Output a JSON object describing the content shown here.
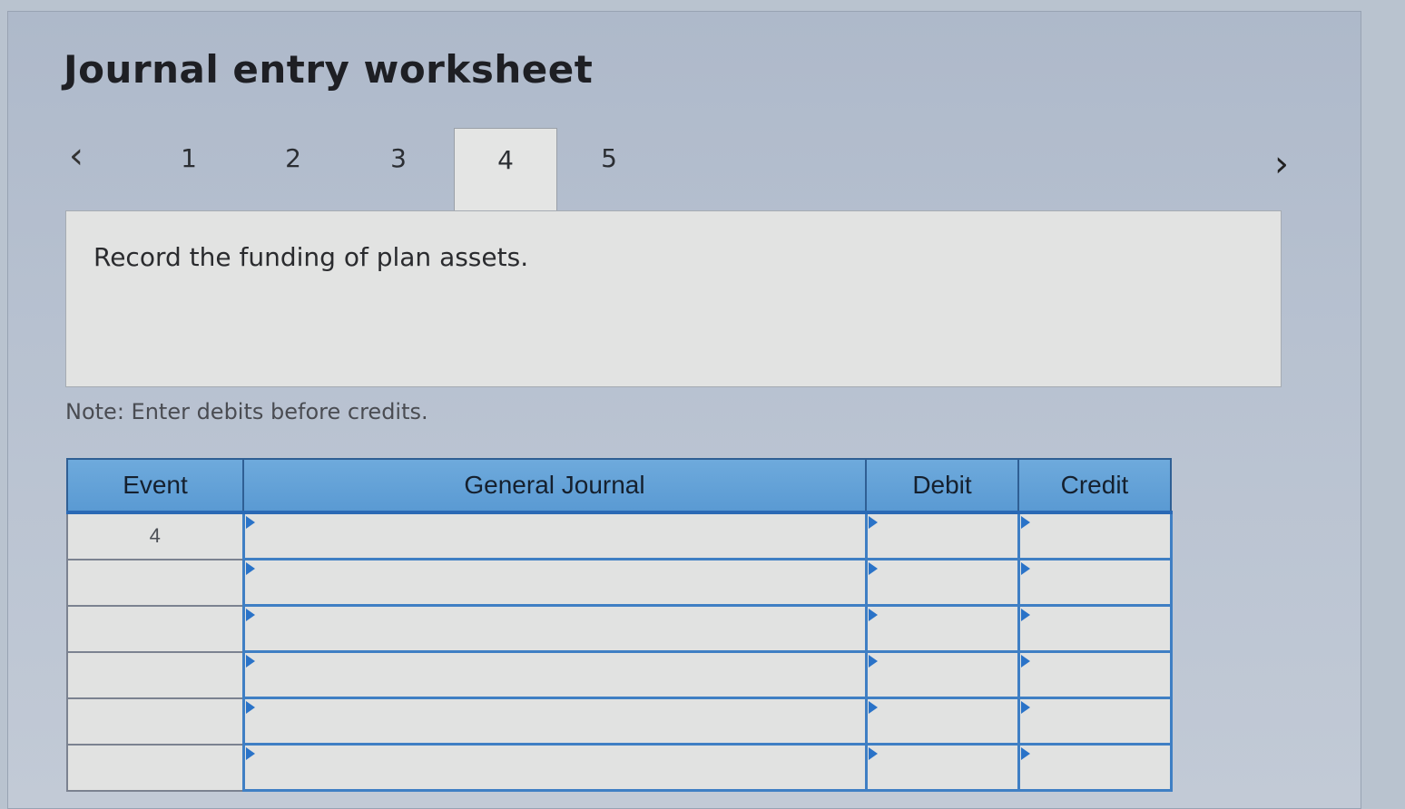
{
  "header": {
    "title": "Journal entry worksheet"
  },
  "nav": {
    "prev_icon": "chevron-left-icon",
    "next_icon": "chevron-right-icon",
    "prev_glyph": "‹",
    "next_glyph": "›",
    "tabs": [
      "1",
      "2",
      "3",
      "4",
      "5"
    ],
    "active_tab": "4"
  },
  "prompt": {
    "text": "Record the funding of plan assets."
  },
  "note": "Note: Enter debits before credits.",
  "table": {
    "headers": [
      "Event",
      "General Journal",
      "Debit",
      "Credit"
    ],
    "rows": [
      {
        "event": "4",
        "account": "",
        "debit": "",
        "credit": ""
      },
      {
        "event": "",
        "account": "",
        "debit": "",
        "credit": ""
      },
      {
        "event": "",
        "account": "",
        "debit": "",
        "credit": ""
      },
      {
        "event": "",
        "account": "",
        "debit": "",
        "credit": ""
      },
      {
        "event": "",
        "account": "",
        "debit": "",
        "credit": ""
      },
      {
        "event": "",
        "account": "",
        "debit": "",
        "credit": ""
      }
    ]
  },
  "colors": {
    "header_blue": "#5a9ad3",
    "grid_blue": "#3f7fc4",
    "cell_bg": "#e1e2e1"
  }
}
